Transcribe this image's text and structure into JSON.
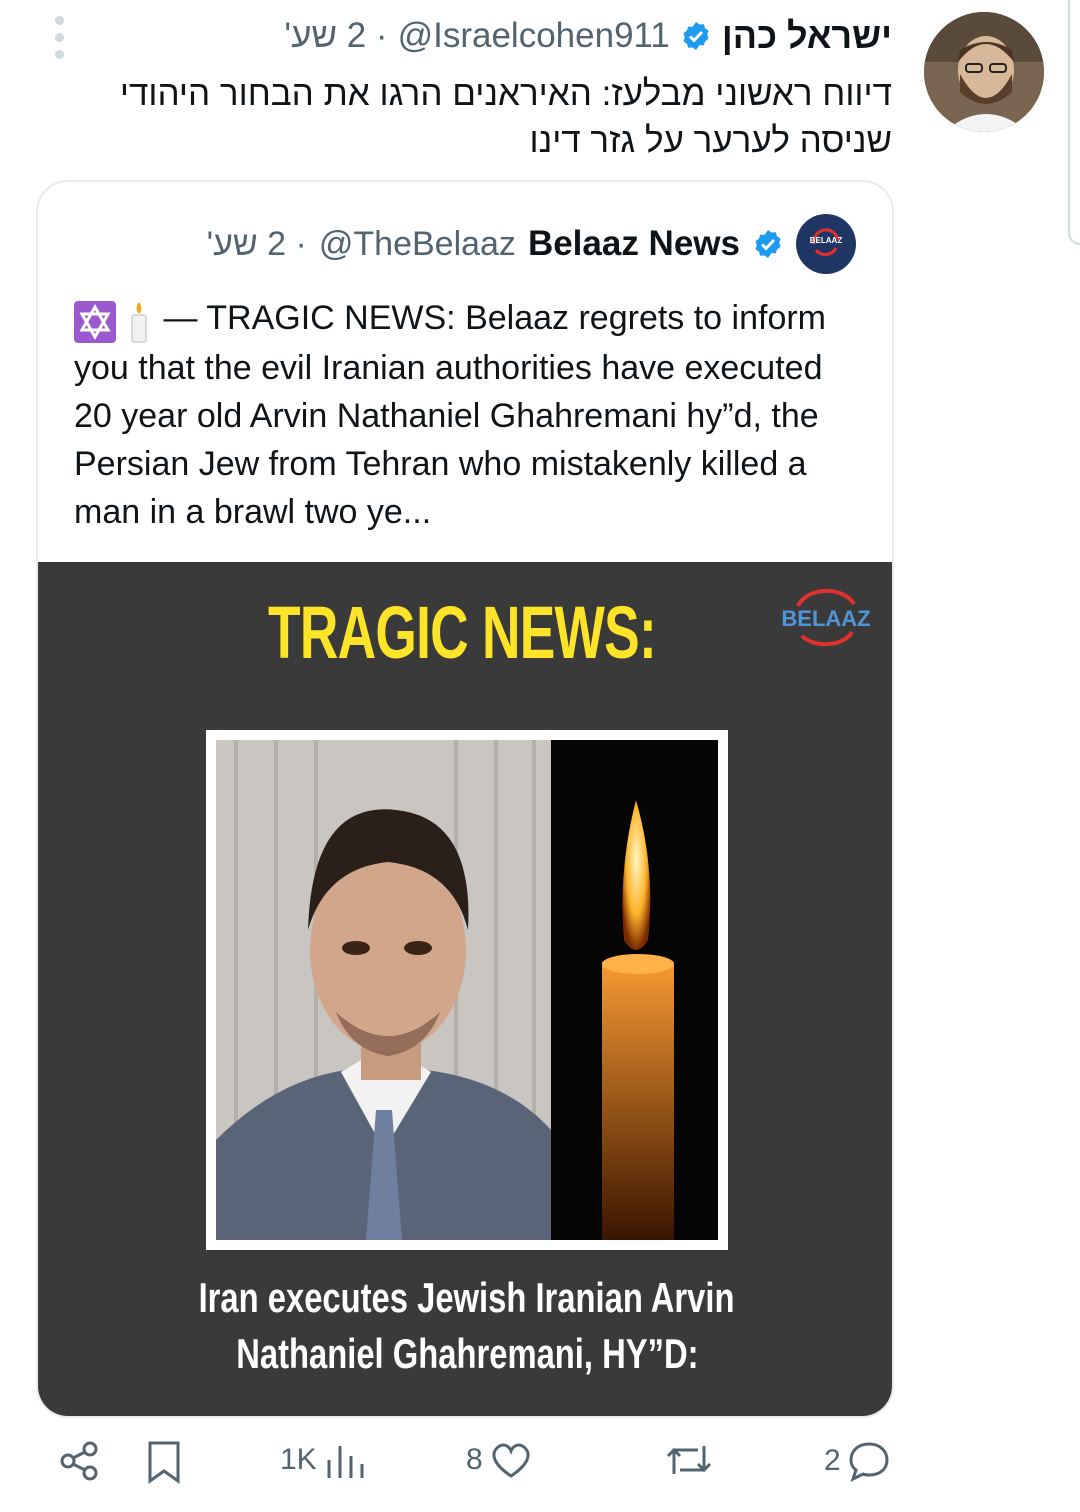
{
  "tweet": {
    "author_name": "ישראל כהן",
    "handle": "@Israelcohen911",
    "time": "· 2 שע'",
    "text": "דיווח ראשוני מבלעז: האיראנים הרגו את הבחור היהודי שניסה לערער על גזר דינו"
  },
  "quote": {
    "author_name": "Belaaz News",
    "handle": "@TheBelaaz",
    "time": "· 2 שע'",
    "avatar_text": "BELAAZ",
    "text": "— TRAGIC NEWS: Belaaz regrets to inform you that the evil Iranian authorities have executed 20 year old Arvin Nathaniel Ghahremani hy”d, the Persian Jew from Tehran who mistakenly killed a man in a brawl two ye...",
    "emojis": [
      "star-of-david",
      "candle"
    ]
  },
  "media": {
    "headline": "TRAGIC NEWS:",
    "logo": "BELAAZ",
    "caption_line1": "Iran executes Jewish Iranian Arvin",
    "caption_line2": "Nathaniel Ghahremani, HY”D:"
  },
  "actions": {
    "views": "1K",
    "likes": "8",
    "replies": "2"
  },
  "colors": {
    "verified": "#1d9bf0",
    "headline": "#fde428",
    "media_bg": "#3a3a3a",
    "muted": "#536471"
  }
}
